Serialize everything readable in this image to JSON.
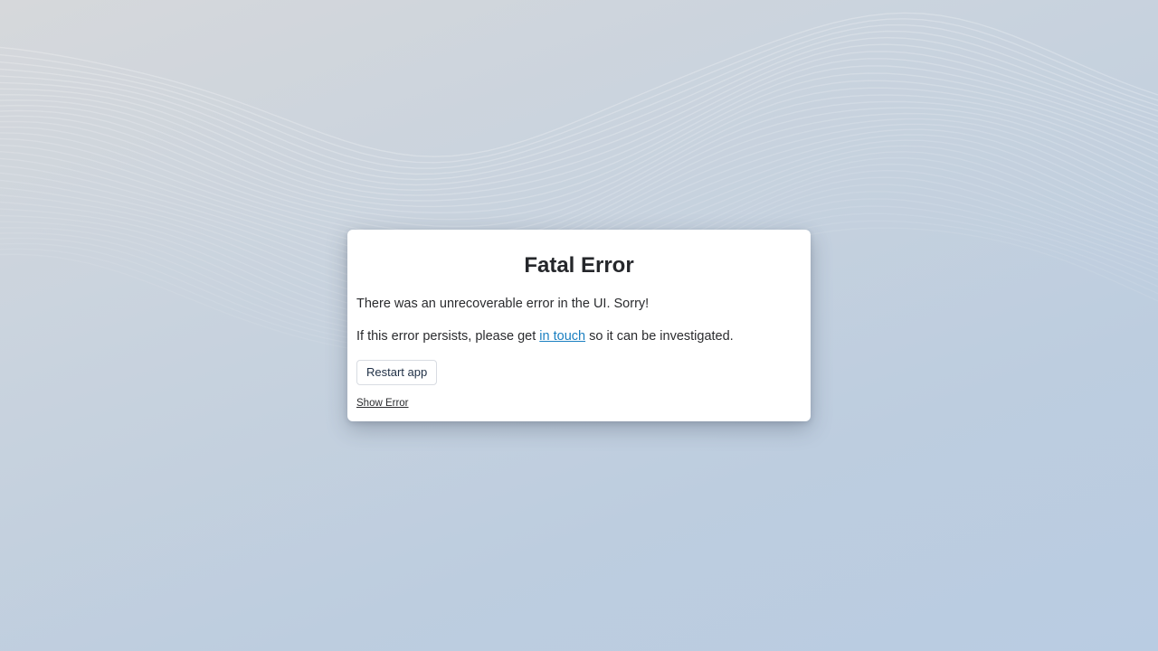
{
  "background": {
    "colors": [
      "#d6d8db",
      "#c9d3de",
      "#bdcddf",
      "#b9cce2"
    ],
    "decoration": "wave-lines"
  },
  "dialog": {
    "title": "Fatal Error",
    "message_1": "There was an unrecoverable error in the UI. Sorry!",
    "message_2_prefix": "If this error persists, please get ",
    "message_2_link": "in touch",
    "message_2_suffix": " so it can be investigated.",
    "restart_label": "Restart app",
    "show_error_label": "Show Error",
    "link_color": "#1a7fc1"
  }
}
